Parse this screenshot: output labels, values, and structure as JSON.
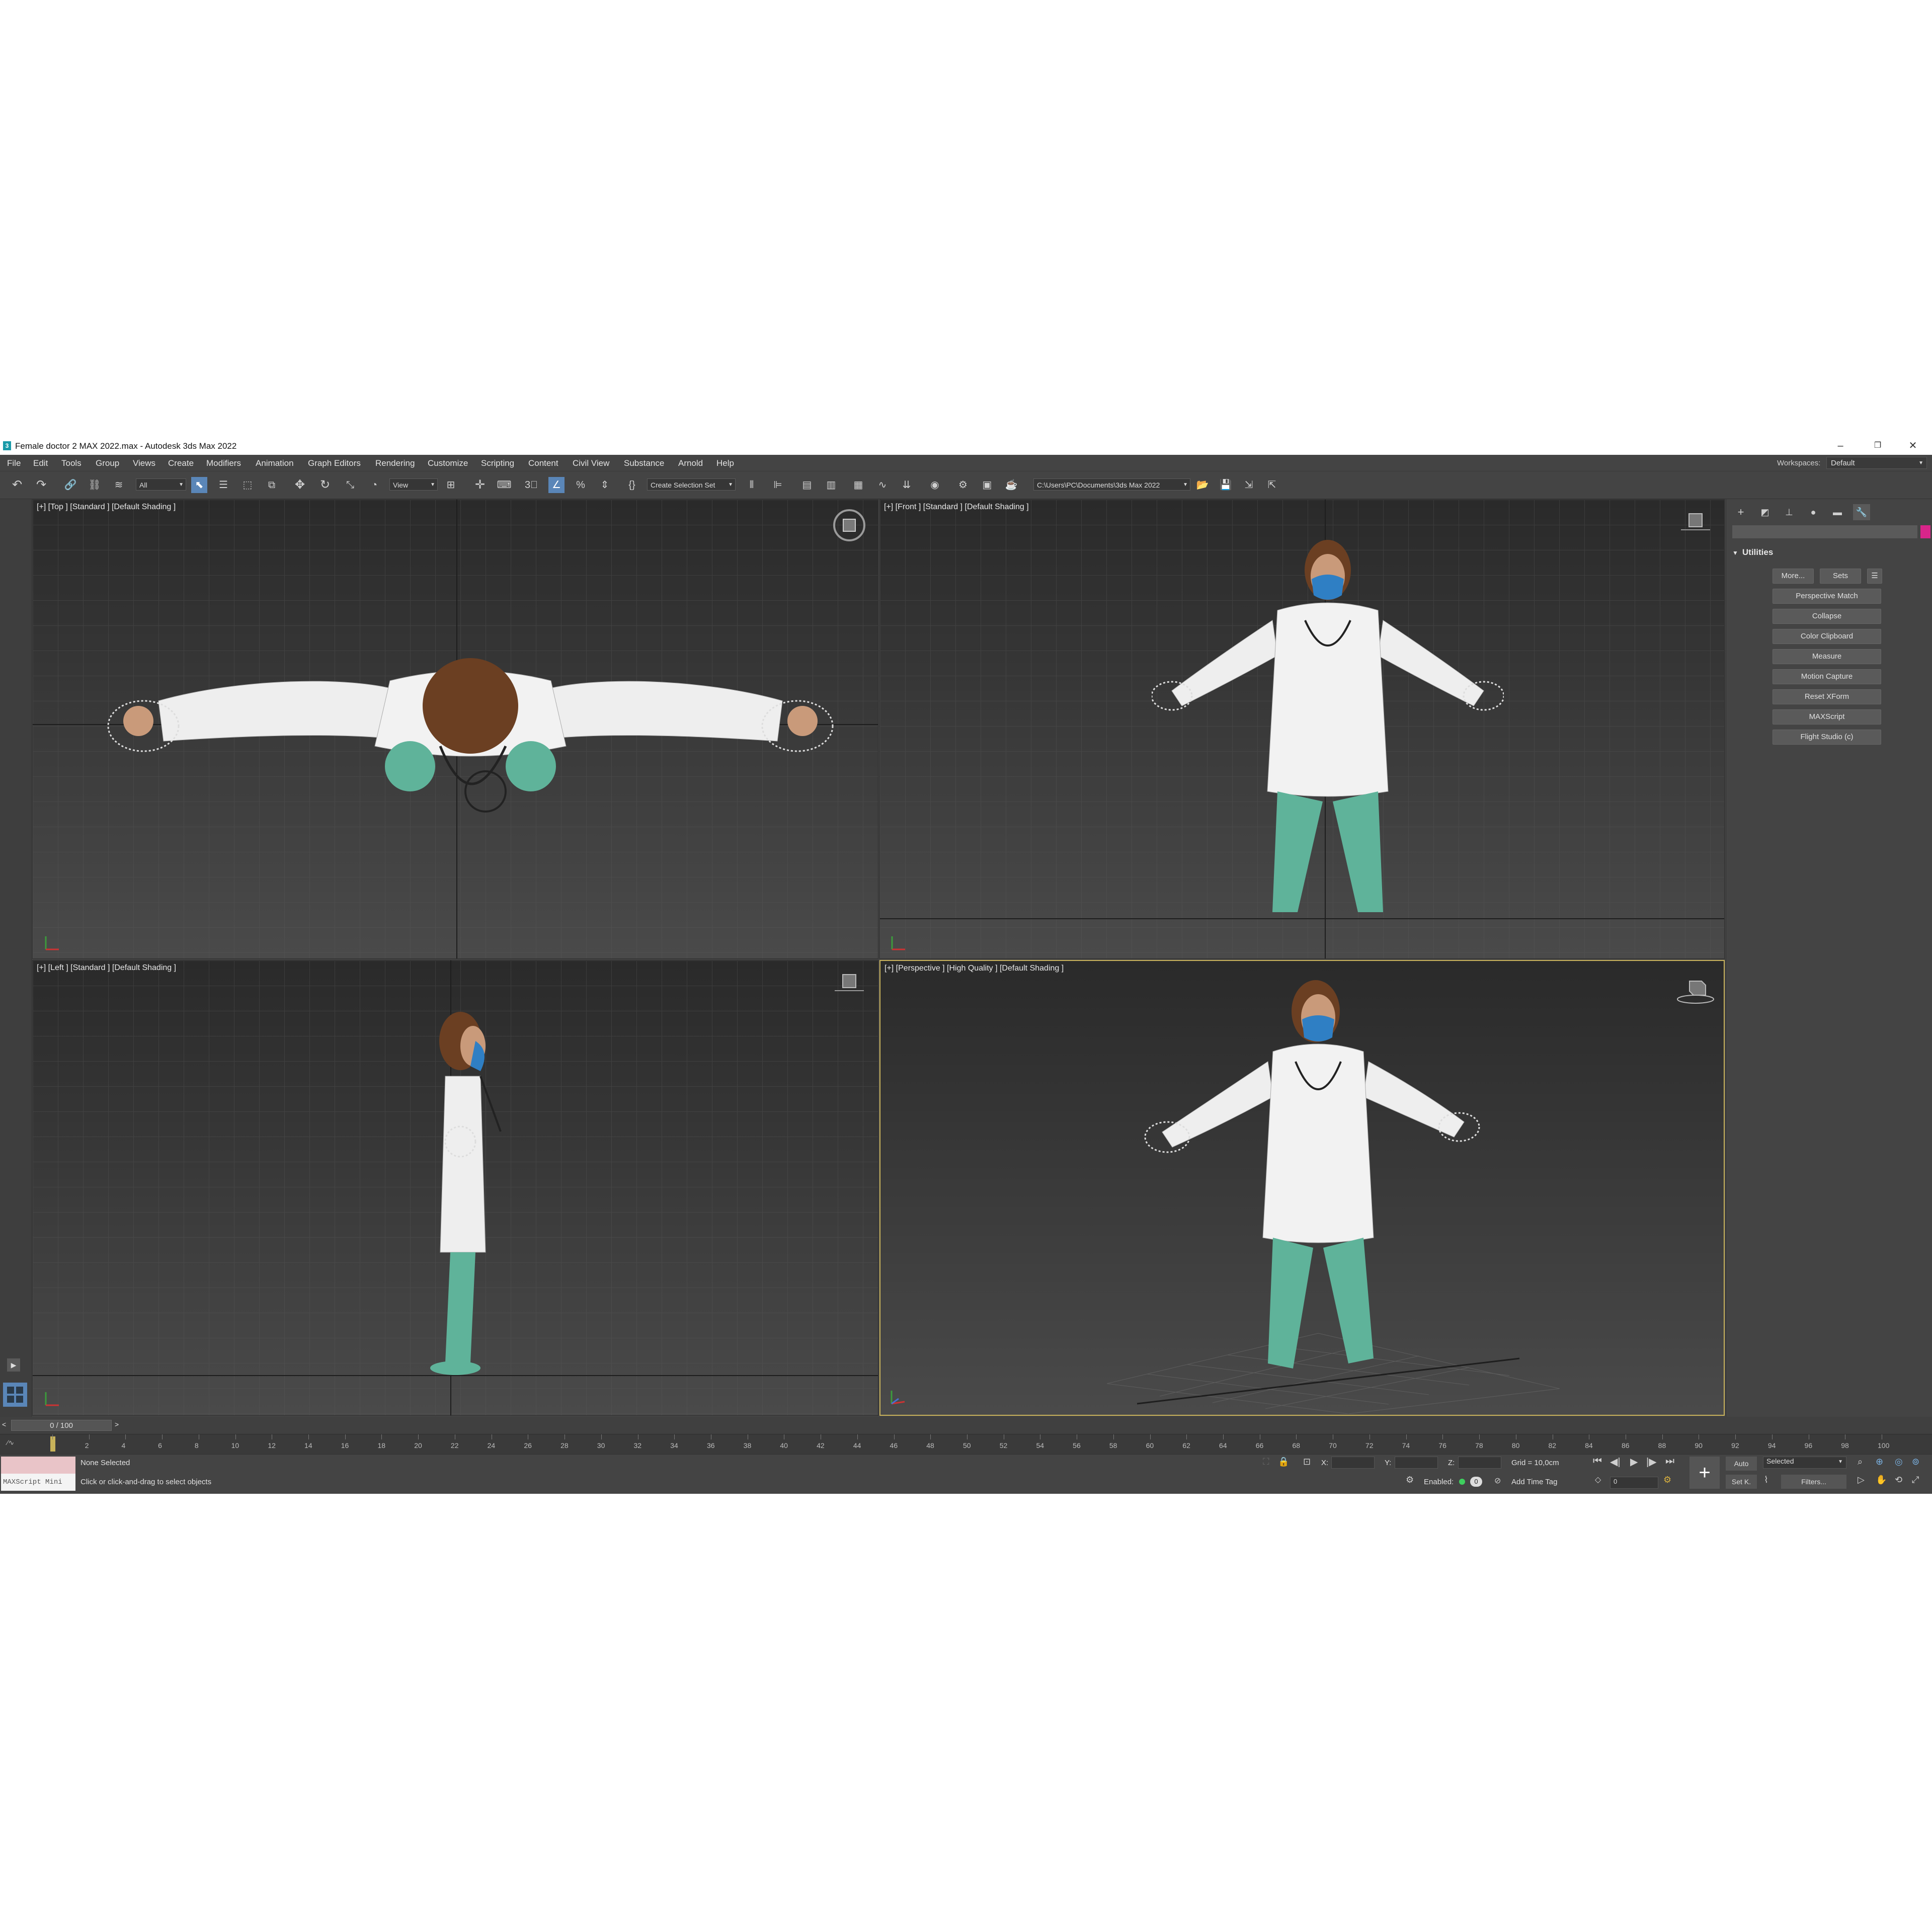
{
  "window": {
    "title": "Female doctor 2 MAX 2022.max - Autodesk 3ds Max 2022",
    "app_icon": "3",
    "controls": [
      "–",
      "❐",
      "✕"
    ]
  },
  "menubar": {
    "items": [
      "File",
      "Edit",
      "Tools",
      "Group",
      "Views",
      "Create",
      "Modifiers",
      "Animation",
      "Graph Editors",
      "Rendering",
      "Customize",
      "Scripting",
      "Content",
      "Civil View",
      "Substance",
      "Arnold",
      "Help"
    ],
    "workspaces_label": "Workspaces:",
    "workspaces_value": "Default"
  },
  "toolbar": {
    "selection_filter": "All",
    "ref_coord": "View",
    "selection_set": "Create Selection Set",
    "project_path": "C:\\Users\\PC\\Documents\\3ds Max 2022"
  },
  "viewports": {
    "top": "[+] [Top ] [Standard ] [Default Shading ]",
    "front": "[+] [Front ] [Standard ] [Default Shading ]",
    "left": "[+] [Left ] [Standard ] [Default Shading ]",
    "perspective": "[+] [Perspective ] [High Quality ] [Default Shading ]"
  },
  "command_panel": {
    "rollout_title": "Utilities",
    "more_button": "More...",
    "sets_button": "Sets",
    "utilities": [
      "Perspective Match",
      "Collapse",
      "Color Clipboard",
      "Measure",
      "Motion Capture",
      "Reset XForm",
      "MAXScript",
      "Flight Studio (c)"
    ]
  },
  "timeline": {
    "frame_display": "0 / 100",
    "prev": "<",
    "next": ">",
    "ticks": [
      "0",
      "2",
      "4",
      "6",
      "8",
      "10",
      "12",
      "14",
      "16",
      "18",
      "20",
      "22",
      "24",
      "26",
      "28",
      "30",
      "32",
      "34",
      "36",
      "38",
      "40",
      "42",
      "44",
      "46",
      "48",
      "50",
      "52",
      "54",
      "56",
      "58",
      "60",
      "62",
      "64",
      "66",
      "68",
      "70",
      "72",
      "74",
      "76",
      "78",
      "80",
      "82",
      "84",
      "86",
      "88",
      "90",
      "92",
      "94",
      "96",
      "98",
      "100"
    ]
  },
  "status": {
    "maxscript_label": "MAXScript Mini",
    "selection": "None Selected",
    "prompt": "Click or click-and-drag to select objects",
    "x_label": "X:",
    "y_label": "Y:",
    "z_label": "Z:",
    "grid": "Grid = 10,0cm",
    "enabled_label": "Enabled:",
    "enabled_value": "0",
    "add_time_tag": "Add Time Tag",
    "auto_key": "Auto",
    "set_key": "Set K.",
    "key_filter": "Selected",
    "filters": "Filters...",
    "current_frame": "0"
  },
  "colors": {
    "lab_coat": "#eeeeee",
    "scrubs": "#5fb39a",
    "mask": "#2f7fc4",
    "hair": "#6b3f22",
    "skin": "#c99a7a",
    "active_viewport_border": "#c9b35c",
    "accent": "#5a86b8"
  }
}
